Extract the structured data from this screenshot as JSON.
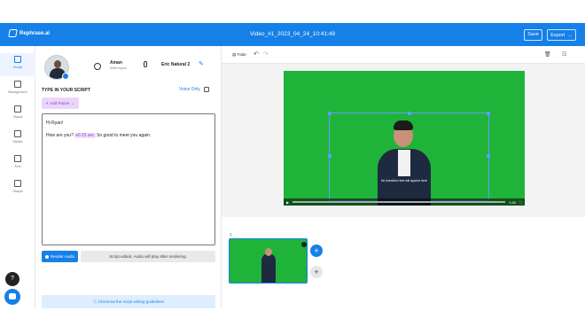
{
  "app": {
    "brand": "Rephrase.ai",
    "video_title": "Video_#1_2023_04_24_10:41:49",
    "save_label": "Save",
    "export_label": "Export"
  },
  "sidebar": {
    "items": [
      {
        "label": "Script",
        "icon": "script-icon"
      },
      {
        "label": "Background",
        "icon": "background-icon"
      },
      {
        "label": "Visual",
        "icon": "visual-icon"
      },
      {
        "label": "Media",
        "icon": "media-icon"
      },
      {
        "label": "Text",
        "icon": "text-icon"
      },
      {
        "label": "Shape",
        "icon": "shape-icon"
      }
    ]
  },
  "panel": {
    "voice_name": "Aman",
    "voice_sub": "Multi lingual",
    "presenter_name": "Eric Natural 2",
    "type_label": "TYPE IN YOUR SCRIPT",
    "voice_only_label": "Voice Only",
    "add_pause_label": "Add Pause",
    "script_line1": "Hi Ryan!",
    "script_line2_a": "How are you?",
    "script_pause_tag": "⏸0.25 sec",
    "script_line2_b": "So good to meet you again.",
    "render_label": "Render Audio",
    "edit_message": "Script edited. Audio will play after rendering.",
    "guide_label": "Checkout the script writing guidelines"
  },
  "editor": {
    "fade_label": "Fade",
    "caption": "No transition text will appear here",
    "time": "0:00",
    "scene_number": "1"
  }
}
